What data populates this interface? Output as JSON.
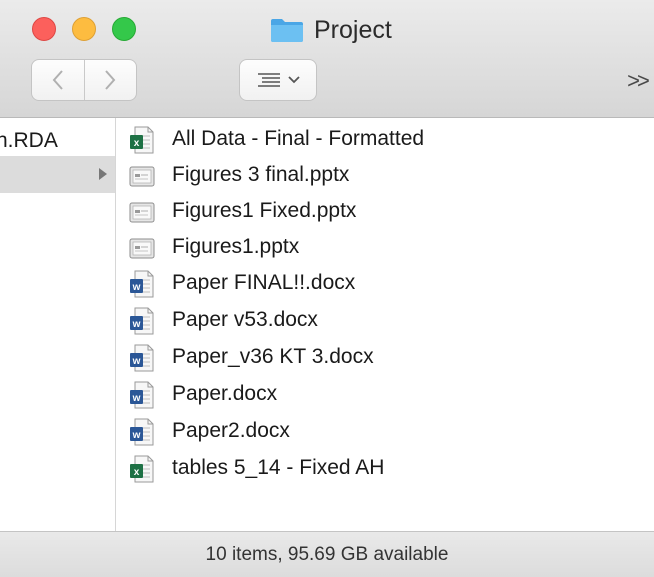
{
  "window": {
    "title": "Project"
  },
  "toolbar": {
    "back_icon": "chevron-left-icon",
    "forward_icon": "chevron-right-icon",
    "view_icon": "list-view-icon",
    "overflow_label": ">>"
  },
  "sidebar": {
    "items": [
      {
        "label": "n.RDA"
      },
      {
        "label": ""
      }
    ]
  },
  "files": [
    {
      "name": "All Data - Final - Formatted",
      "icon": "excel-icon"
    },
    {
      "name": "Figures 3 final.pptx",
      "icon": "pptx-icon"
    },
    {
      "name": "Figures1 Fixed.pptx",
      "icon": "pptx-icon"
    },
    {
      "name": "Figures1.pptx",
      "icon": "pptx-icon"
    },
    {
      "name": "Paper FINAL!!.docx",
      "icon": "word-icon"
    },
    {
      "name": "Paper v53.docx",
      "icon": "word-icon"
    },
    {
      "name": "Paper_v36 KT 3.docx",
      "icon": "word-icon"
    },
    {
      "name": "Paper.docx",
      "icon": "word-icon"
    },
    {
      "name": "Paper2.docx",
      "icon": "word-icon"
    },
    {
      "name": "tables 5_14 - Fixed AH",
      "icon": "excel-icon"
    }
  ],
  "status": {
    "text": "10 items, 95.69 GB available"
  },
  "colors": {
    "close": "#fc605c",
    "minimize": "#fdbc40",
    "maximize": "#34c84a",
    "folder": "#5fb5ec",
    "excel": "#1e7145",
    "word": "#2b5797"
  }
}
